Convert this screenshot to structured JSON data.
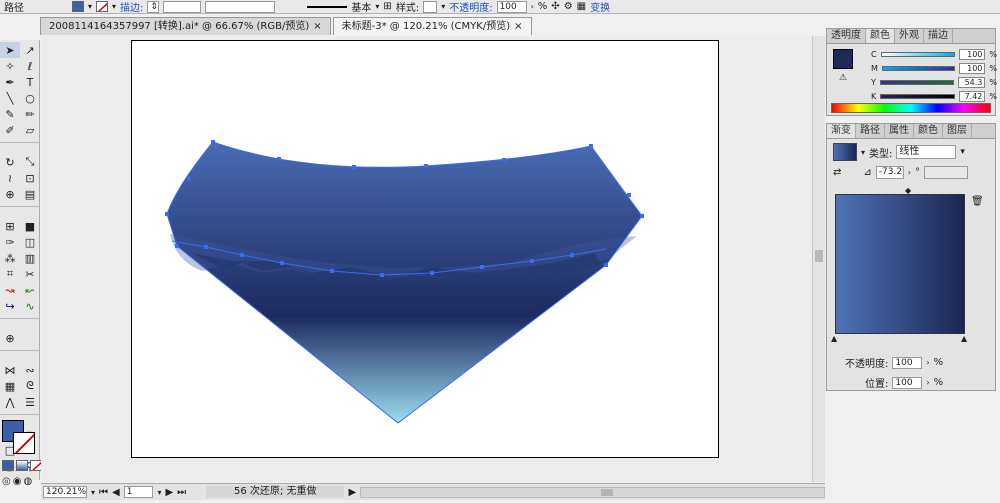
{
  "control_bar": {
    "path_label": "路径",
    "stroke_label": "描边:",
    "stroke_value": "",
    "brush_label": "基本",
    "style_label": "样式:",
    "opacity_label": "不透明度:",
    "opacity_value": "100",
    "percent": "%",
    "transform_label": "变换"
  },
  "doc_tabs": [
    {
      "label": "2008114164357997 [转换].ai* @ 66.67% (RGB/预览)",
      "close": "×"
    },
    {
      "label": "未标题-3* @ 120.21% (CMYK/预览)",
      "close": "×"
    }
  ],
  "status_bar": {
    "zoom": "120.21%",
    "page": "1",
    "message": "56 次还原; 无重做"
  },
  "color_panel": {
    "tabs": [
      "透明度",
      "颜色",
      "外观",
      "描边"
    ],
    "active_tab": "颜色",
    "channels": [
      {
        "name": "C",
        "value": "100",
        "level": 1.0
      },
      {
        "name": "M",
        "value": "100",
        "level": 1.0
      },
      {
        "name": "Y",
        "value": "54.3",
        "level": 0.543
      },
      {
        "name": "K",
        "value": "7.42",
        "level": 0.074
      }
    ],
    "fill_color": "#1e2a5c"
  },
  "gradient_panel": {
    "tabs": [
      "渐变",
      "路径",
      "属性",
      "颜色",
      "图层"
    ],
    "active_tab": "渐变",
    "type_label": "类型:",
    "type_value": "线性",
    "angle_value": "-73.2",
    "angle_unit": "°",
    "opacity_label": "不透明度:",
    "opacity_value": "100",
    "location_label": "位置:",
    "location_value": "100",
    "percent": "%",
    "gradient_start": "#4f72b8",
    "gradient_end": "#1b2652"
  },
  "colors": {
    "shape_top": "#4a6cb3",
    "shape_mid": "#1c2a5f",
    "shape_bottom": "#9bdcf0",
    "selection": "#3a6cf0"
  }
}
